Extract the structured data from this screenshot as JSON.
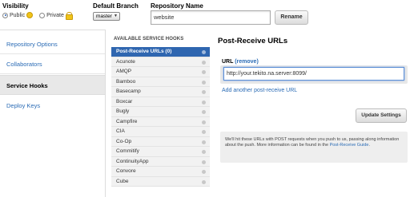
{
  "top": {
    "visibility_label": "Visibility",
    "public_label": "Public",
    "private_label": "Private",
    "branch_label": "Default Branch",
    "branch_value": "master",
    "repo_label": "Repository Name",
    "repo_value": "website",
    "rename_label": "Rename"
  },
  "sidebar": {
    "items": [
      {
        "label": "Repository Options"
      },
      {
        "label": "Collaborators"
      },
      {
        "label": "Service Hooks"
      },
      {
        "label": "Deploy Keys"
      }
    ]
  },
  "hooks": {
    "title": "AVAILABLE SERVICE HOOKS",
    "items": [
      {
        "label": "Post-Receive URLs (0)"
      },
      {
        "label": "Acunote"
      },
      {
        "label": "AMQP"
      },
      {
        "label": "Bamboo"
      },
      {
        "label": "Basecamp"
      },
      {
        "label": "Boxcar"
      },
      {
        "label": "Bugly"
      },
      {
        "label": "Campfire"
      },
      {
        "label": "CIA"
      },
      {
        "label": "Co-Op"
      },
      {
        "label": "Commitify"
      },
      {
        "label": "ContinuityApp"
      },
      {
        "label": "Convore"
      },
      {
        "label": "Cube"
      }
    ]
  },
  "panel": {
    "title": "Post-Receive URLs",
    "url_label": "URL",
    "remove_label": "(remove)",
    "url_value": "http://your.tekito.na.server:8099/",
    "add_link": "Add another post-receive URL",
    "update_label": "Update Settings",
    "info_text": "We'll hit these URLs with POST requests when you push to us, passing along information about the push. More information can be found in the ",
    "info_link": "Post-Receive Guide",
    "info_end": "."
  },
  "colors": {
    "accent": "#2f66b0",
    "link": "#2a6bb5"
  }
}
